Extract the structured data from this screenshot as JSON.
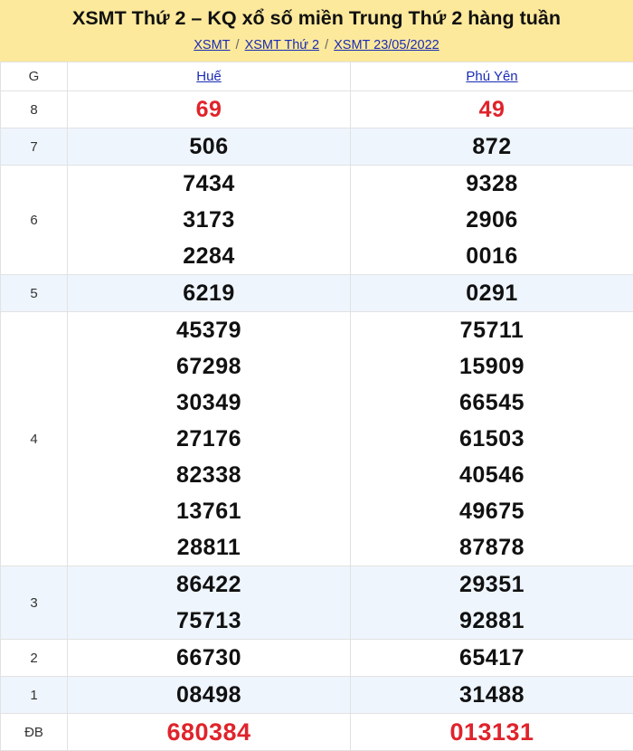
{
  "header": {
    "title": "XSMT Thứ 2 – KQ xổ số miền Trung Thứ 2 hàng tuần",
    "breadcrumb": [
      "XSMT",
      "XSMT Thứ 2",
      "XSMT 23/05/2022"
    ],
    "separator": "/"
  },
  "table": {
    "prize_header": "G",
    "provinces": [
      "Huế",
      "Phú Yên"
    ],
    "rows": [
      {
        "prize": "8",
        "alt": false,
        "red": true,
        "numbers": [
          [
            "69"
          ],
          [
            "49"
          ]
        ]
      },
      {
        "prize": "7",
        "alt": true,
        "red": false,
        "numbers": [
          [
            "506"
          ],
          [
            "872"
          ]
        ]
      },
      {
        "prize": "6",
        "alt": false,
        "red": false,
        "numbers": [
          [
            "7434",
            "3173",
            "2284"
          ],
          [
            "9328",
            "2906",
            "0016"
          ]
        ]
      },
      {
        "prize": "5",
        "alt": true,
        "red": false,
        "numbers": [
          [
            "6219"
          ],
          [
            "0291"
          ]
        ]
      },
      {
        "prize": "4",
        "alt": false,
        "red": false,
        "numbers": [
          [
            "45379",
            "67298",
            "30349",
            "27176",
            "82338",
            "13761",
            "28811"
          ],
          [
            "75711",
            "15909",
            "66545",
            "61503",
            "40546",
            "49675",
            "87878"
          ]
        ]
      },
      {
        "prize": "3",
        "alt": true,
        "red": false,
        "numbers": [
          [
            "86422",
            "75713"
          ],
          [
            "29351",
            "92881"
          ]
        ]
      },
      {
        "prize": "2",
        "alt": false,
        "red": false,
        "numbers": [
          [
            "66730"
          ],
          [
            "65417"
          ]
        ]
      },
      {
        "prize": "1",
        "alt": true,
        "red": false,
        "numbers": [
          [
            "08498"
          ],
          [
            "31488"
          ]
        ]
      },
      {
        "prize": "ĐB",
        "alt": false,
        "red": true,
        "big": true,
        "numbers": [
          [
            "680384"
          ],
          [
            "013131"
          ]
        ]
      }
    ]
  },
  "colors": {
    "header_bg": "#fde99b",
    "link": "#1a2bb5",
    "alt_row": "#eef5fd",
    "highlight": "#e0232b"
  }
}
